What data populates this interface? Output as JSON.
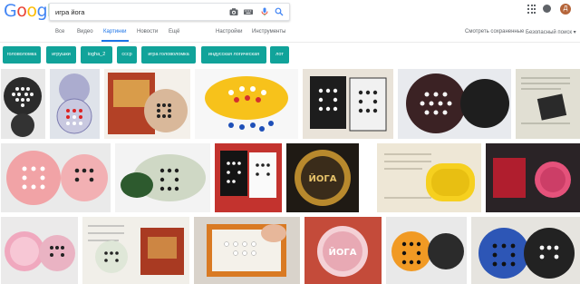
{
  "header": {
    "logo": {
      "letters": [
        "G",
        "o",
        "o",
        "g",
        "l",
        "e"
      ],
      "colors": [
        "#4285f4",
        "#ea4335",
        "#fbbc05",
        "#4285f4",
        "#34a853",
        "#ea4335"
      ]
    },
    "search_value": "игра йога",
    "icons": [
      "camera-icon",
      "keyboard-icon",
      "microphone-icon",
      "search-icon"
    ],
    "avatar_letter": "Д",
    "avatar_color": "#b5653a"
  },
  "tabs": {
    "items": [
      "Все",
      "Видео",
      "Картинки",
      "Новости",
      "Ещё"
    ],
    "active": "Картинки",
    "tools": [
      "Настройки",
      "Инструменты"
    ],
    "right": [
      "Смотреть сохраненные",
      "Безопасный поиск ▾"
    ]
  },
  "chips": [
    "головоломка",
    "игрушки",
    "iogha_2",
    "ссср",
    "игра головоломка",
    "индусская логическая",
    "лот"
  ],
  "chip_color": "#11a39a",
  "images": [
    {
      "subject": "black round case with white pegs",
      "label": ""
    },
    {
      "subject": "transparent purple case with red and white pegs",
      "label": ""
    },
    {
      "subject": "box with ornament and board",
      "label": ""
    },
    {
      "subject": "yellow board with blue and red pegs",
      "label": ""
    },
    {
      "subject": "two square boards black and white",
      "label": ""
    },
    {
      "subject": "dark round board with white pegs",
      "label": ""
    },
    {
      "subject": "instruction sheet with black square",
      "label": ""
    },
    {
      "subject": "pink round case with pegs",
      "label": ""
    },
    {
      "subject": "green case with pegs",
      "label": ""
    },
    {
      "subject": "square boards on red background",
      "label": ""
    },
    {
      "subject": "round lid with ornament",
      "label": "ЙОГА"
    },
    {
      "subject": "yellow case on paper",
      "label": ""
    },
    {
      "subject": "red and pink case on dark",
      "label": ""
    },
    {
      "subject": "pink round case open",
      "label": ""
    },
    {
      "subject": "instruction sheet and box",
      "label": ""
    },
    {
      "subject": "hand on peg board",
      "label": ""
    },
    {
      "subject": "pink lid with ornament",
      "label": "ЙОГА"
    },
    {
      "subject": "orange board black pegs",
      "label": ""
    },
    {
      "subject": "blue round case with pegs",
      "label": ""
    }
  ]
}
